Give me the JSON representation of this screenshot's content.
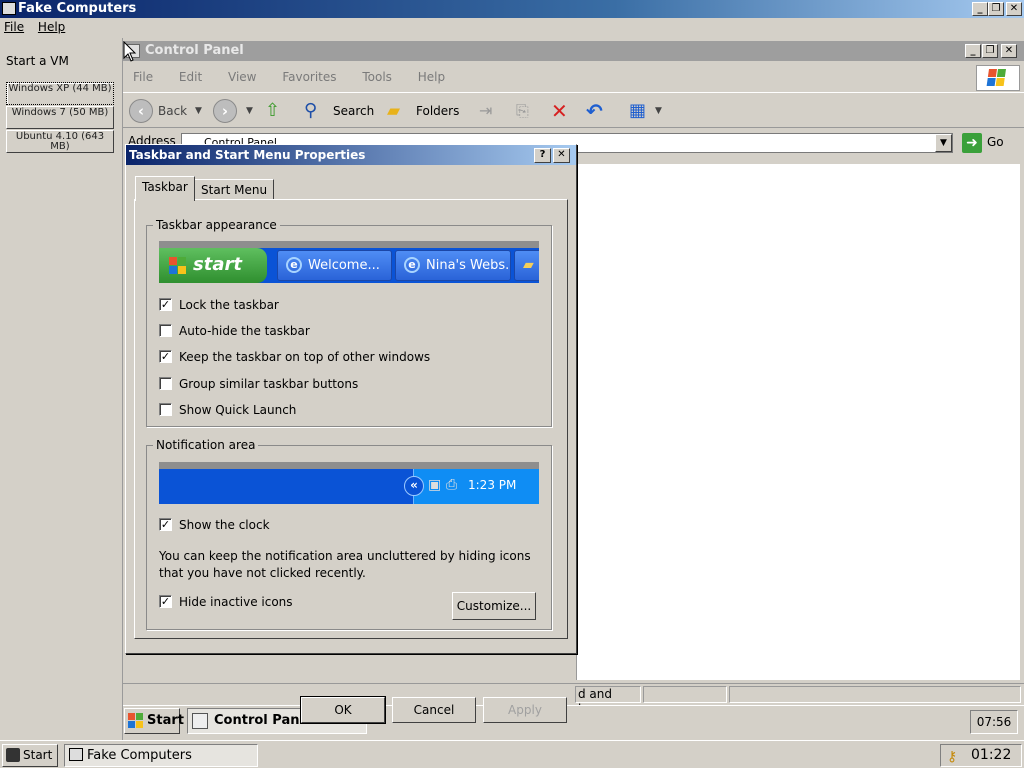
{
  "host": {
    "title": "Fake Computers",
    "menu": [
      "File",
      "Help"
    ],
    "side_heading": "Start a VM",
    "vm_buttons": [
      "Windows XP (44 MB)",
      "Windows 7 (50 MB)",
      "Ubuntu 4.10 (643 MB)"
    ],
    "taskbar": {
      "start_label": "Start",
      "task_label": "Fake Computers",
      "clock": "01:22"
    }
  },
  "control_panel": {
    "title": "Control Panel",
    "menu": [
      "File",
      "Edit",
      "View",
      "Favorites",
      "Tools",
      "Help"
    ],
    "toolbar": {
      "back": "Back",
      "search": "Search",
      "folders": "Folders"
    },
    "address_label": "Address",
    "address_value": "Control Panel",
    "go_label": "Go",
    "status_text": "d and how"
  },
  "guest_taskbar": {
    "start_label": "Start",
    "task_label": "Control Panel",
    "clock": "07:56"
  },
  "dialog": {
    "title": "Taskbar and Start Menu Properties",
    "tabs": [
      "Taskbar",
      "Start Menu"
    ],
    "appearance": {
      "legend": "Taskbar appearance",
      "preview_start": "start",
      "preview_tasks": [
        "Welcome...",
        "Nina's Webs..."
      ],
      "options": [
        {
          "label": "Lock the taskbar",
          "checked": true
        },
        {
          "label": "Auto-hide the taskbar",
          "checked": false
        },
        {
          "label": "Keep the taskbar on top of other windows",
          "checked": true
        },
        {
          "label": "Group similar taskbar buttons",
          "checked": false
        },
        {
          "label": "Show Quick Launch",
          "checked": false
        }
      ]
    },
    "notification": {
      "legend": "Notification area",
      "preview_clock": "1:23 PM",
      "show_clock": {
        "label": "Show the clock",
        "checked": true
      },
      "description": "You can keep the notification area uncluttered by hiding icons that you have not clicked recently.",
      "hide_inactive": {
        "label": "Hide inactive icons",
        "checked": true
      },
      "customize_label": "Customize..."
    },
    "buttons": {
      "ok": "OK",
      "cancel": "Cancel",
      "apply": "Apply"
    }
  }
}
